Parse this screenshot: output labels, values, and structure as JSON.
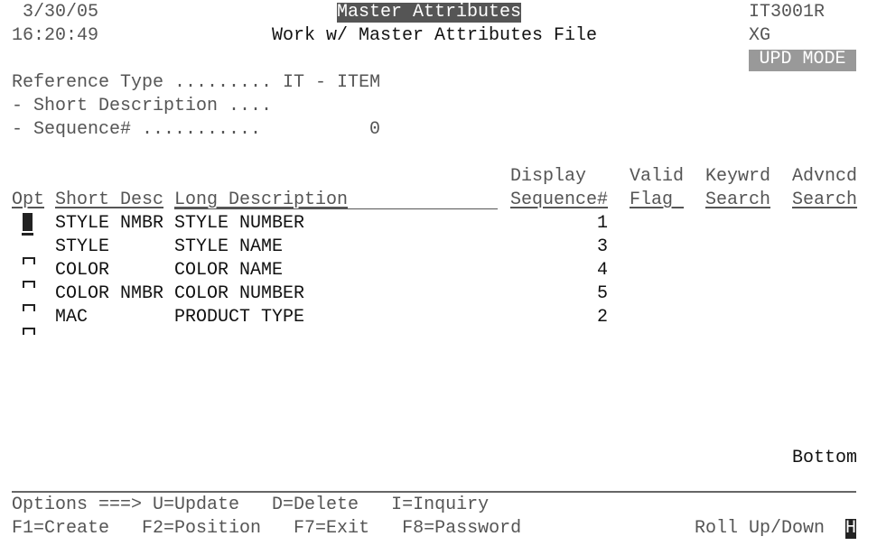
{
  "header": {
    "date": "3/30/05",
    "time": "16:20:49",
    "title": "Master Attributes",
    "subtitle": "Work w/ Master Attributes File",
    "program": "IT3001R",
    "user": "XG",
    "mode": "UPD MODE"
  },
  "filters": {
    "reference_type": "Reference Type ......... IT - ITEM",
    "short_description": "- Short Description ....",
    "sequence_label": "- Sequence# ...........",
    "sequence_value": "0"
  },
  "columns": {
    "opt": "Opt",
    "short_desc": "Short Desc",
    "long_desc": "Long Description",
    "display_top": "Display",
    "display_bottom": "Sequence#",
    "valid_top": "Valid",
    "valid_bottom": "Flag ",
    "keyword_top": "Keywrd",
    "keyword_bottom": "Search",
    "advanced_top": "Advncd",
    "advanced_bottom": "Search"
  },
  "rows": [
    {
      "short": "STYLE NMBR",
      "long": "STYLE NUMBER",
      "seq": "1"
    },
    {
      "short": "STYLE",
      "long": "STYLE NAME",
      "seq": "3"
    },
    {
      "short": "COLOR",
      "long": "COLOR NAME",
      "seq": "4"
    },
    {
      "short": "COLOR NMBR",
      "long": "COLOR NUMBER",
      "seq": "5"
    },
    {
      "short": "MAC",
      "long": "PRODUCT TYPE",
      "seq": "2"
    }
  ],
  "list_status": "Bottom",
  "footer": {
    "options": "Options ===> U=Update   D=Delete   I=Inquiry",
    "keys": "F1=Create   F2=Position   F7=Exit   F8=Password",
    "roll": "Roll Up/Down",
    "cursor_char": "H"
  }
}
